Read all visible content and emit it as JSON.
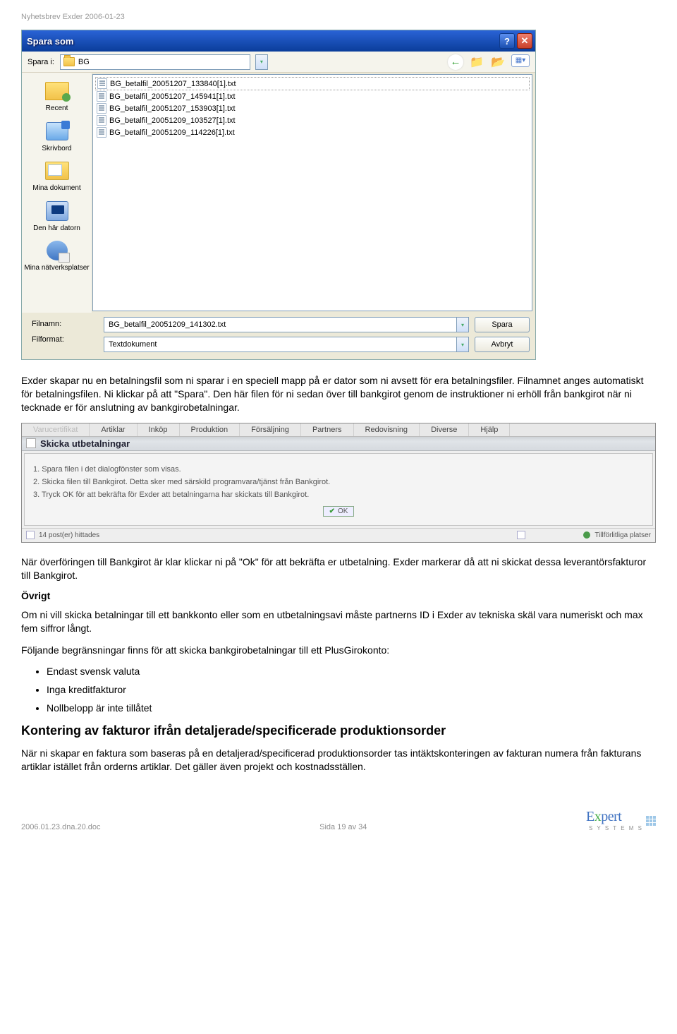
{
  "header": "Nyhetsbrev Exder 2006-01-23",
  "dialog": {
    "title": "Spara som",
    "spara_i_label": "Spara i:",
    "folder_name": "BG",
    "sidebar": {
      "recent": "Recent",
      "desktop": "Skrivbord",
      "documents": "Mina dokument",
      "computer": "Den här datorn",
      "network": "Mina nätverksplatser"
    },
    "files": [
      "BG_betalfil_20051207_133840[1].txt",
      "BG_betalfil_20051207_145941[1].txt",
      "BG_betalfil_20051207_153903[1].txt",
      "BG_betalfil_20051209_103527[1].txt",
      "BG_betalfil_20051209_114226[1].txt"
    ],
    "filnamn_label": "Filnamn:",
    "filformat_label": "Filformat:",
    "filnamn_value": "BG_betalfil_20051209_141302.txt",
    "filformat_value": "Textdokument",
    "save_btn": "Spara",
    "cancel_btn": "Avbryt"
  },
  "para1": "Exder skapar nu en betalningsfil som ni sparar i en speciell mapp på er dator som ni avsett för era betalningsfiler. Filnamnet anges automatiskt för betalningsfilen. Ni klickar på att \"Spara\". Den här filen för ni sedan över till bankgirot genom de instruktioner ni erhöll från bankgirot när ni tecknade er för anslutning av bankgirobetalningar.",
  "exder": {
    "menu": {
      "varucertifikat": "Varucertifikat",
      "artiklar": "Artiklar",
      "inkop": "Inköp",
      "produktion": "Produktion",
      "forsaljning": "Försäljning",
      "partners": "Partners",
      "redovisning": "Redovisning",
      "diverse": "Diverse",
      "hjalp": "Hjälp"
    },
    "title": "Skicka utbetalningar",
    "step1": "1. Spara filen i det dialogfönster som visas.",
    "step2": "2. Skicka filen till Bankgirot. Detta sker med särskild programvara/tjänst från Bankgirot.",
    "step3": "3. Tryck OK för att bekräfta för Exder att betalningarna har skickats till Bankgirot.",
    "ok": "OK",
    "status_left": "14 post(er) hittades",
    "status_right": "Tillförlitliga platser"
  },
  "para2": "När överföringen till Bankgirot är klar klickar ni på \"Ok\" för att bekräfta er utbetalning. Exder markerar då att ni skickat dessa leverantörsfakturor till Bankgirot.",
  "ovrigt_heading": "Övrigt",
  "para3": "Om ni vill skicka betalningar till ett bankkonto eller som en utbetalningsavi måste partnerns ID i Exder av tekniska skäl vara numeriskt och max fem siffror långt.",
  "para4": "Följande begränsningar finns för att skicka bankgirobetalningar till ett PlusGirokonto:",
  "bullets": {
    "b1": "Endast svensk valuta",
    "b2": "Inga kreditfakturor",
    "b3": "Nollbelopp är inte tillåtet"
  },
  "h2": "Kontering av fakturor ifrån detaljerade/specificerade produktionsorder",
  "para5": "När ni skapar en faktura som baseras på en detaljerad/specificerad produktionsorder tas intäktskonteringen av fakturan numera från fakturans artiklar istället från orderns artiklar. Det gäller även projekt och kostnadsställen.",
  "footer": {
    "left": "2006.01.23.dna.20.doc",
    "center": "Sida 19 av 34",
    "logo_text": "Expert",
    "logo_sub": "S Y S T E M S"
  }
}
